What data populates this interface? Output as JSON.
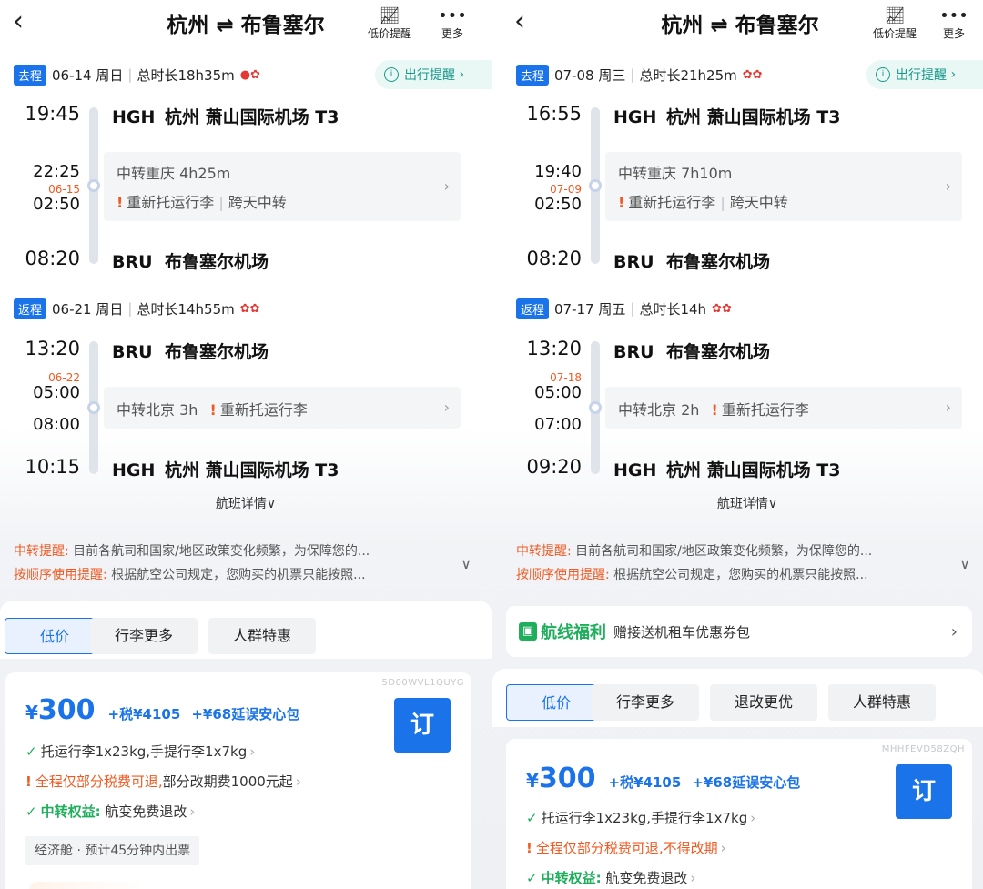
{
  "panels": [
    {
      "header": {
        "back_icon": "back-arrow-icon",
        "title": "杭州 ⇌ 布鲁塞尔",
        "actions": [
          {
            "icon": "price-alert-icon",
            "label": "低价提醒"
          },
          {
            "icon": "more-icon",
            "label": "更多"
          }
        ]
      },
      "outbound": {
        "tag": "去程",
        "date": "06-14 周日",
        "duration": "总时长18h35m",
        "notice": "出行提醒",
        "dep_time": "19:45",
        "dep_code": "HGH",
        "dep_airport": "杭州 萧山国际机场 T3",
        "arr1_time": "22:25",
        "next_date": "06-15",
        "dep2_time": "02:50",
        "transfer": "中转重庆 4h25m",
        "transfer_note": "重新托运行李",
        "transfer_note2": "跨天中转",
        "arr_time": "08:20",
        "arr_code": "BRU",
        "arr_airport": "布鲁塞尔机场"
      },
      "return": {
        "tag": "返程",
        "date": "06-21 周日",
        "duration": "总时长14h55m",
        "dep_time": "13:20",
        "dep_code": "BRU",
        "dep_airport": "布鲁塞尔机场",
        "next_date": "06-22",
        "arr1_time": "05:00",
        "dep2_time": "08:00",
        "transfer": "中转北京 3h",
        "transfer_note": "重新托运行李",
        "arr_time": "10:15",
        "arr_code": "HGH",
        "arr_airport": "杭州 萧山国际机场 T3"
      },
      "detail_link": "航班详情",
      "reminders": [
        {
          "key": "中转提醒:",
          "text": "目前各航司和国家/地区政策变化频繁，为保障您的..."
        },
        {
          "key": "按顺序使用提醒:",
          "text": "根据航空公司规定，您购买的机票只能按照..."
        }
      ],
      "tabs": [
        "低价",
        "行李更多",
        "人群特惠"
      ],
      "offer": {
        "code": "5D00WVL1QUYG",
        "currency": "¥",
        "price": "300",
        "tax": "+税¥4105",
        "addon": "+¥68延误安心包",
        "book": "订",
        "features": [
          {
            "type": "check",
            "text": "托运行李1x23kg,手提行李1x7kg"
          },
          {
            "type": "warn",
            "text": "全程仅部分税费可退,",
            "text2": "部分改期费1000元起"
          },
          {
            "type": "green",
            "label": "中转权益:",
            "text": " 航变免费退改"
          }
        ],
        "cabin": "经济舱 · 预计45分钟内出票"
      }
    },
    {
      "header": {
        "back_icon": "back-arrow-icon",
        "title": "杭州 ⇌ 布鲁塞尔",
        "actions": [
          {
            "icon": "price-alert-icon",
            "label": "低价提醒"
          },
          {
            "icon": "more-icon",
            "label": "更多"
          }
        ]
      },
      "outbound": {
        "tag": "去程",
        "date": "07-08 周三",
        "duration": "总时长21h25m",
        "notice": "出行提醒",
        "dep_time": "16:55",
        "dep_code": "HGH",
        "dep_airport": "杭州 萧山国际机场 T3",
        "arr1_time": "19:40",
        "next_date": "07-09",
        "dep2_time": "02:50",
        "transfer": "中转重庆 7h10m",
        "transfer_note": "重新托运行李",
        "transfer_note2": "跨天中转",
        "arr_time": "08:20",
        "arr_code": "BRU",
        "arr_airport": "布鲁塞尔机场"
      },
      "return": {
        "tag": "返程",
        "date": "07-17 周五",
        "duration": "总时长14h",
        "dep_time": "13:20",
        "dep_code": "BRU",
        "dep_airport": "布鲁塞尔机场",
        "next_date": "07-18",
        "arr1_time": "05:00",
        "dep2_time": "07:00",
        "transfer": "中转北京 2h",
        "transfer_note": "重新托运行李",
        "arr_time": "09:20",
        "arr_code": "HGH",
        "arr_airport": "杭州 萧山国际机场 T3"
      },
      "detail_link": "航班详情",
      "reminders": [
        {
          "key": "中转提醒:",
          "text": "目前各航司和国家/地区政策变化频繁，为保障您的..."
        },
        {
          "key": "按顺序使用提醒:",
          "text": "根据航空公司规定，您购买的机票只能按照..."
        }
      ],
      "benefit": {
        "title": "航线福利",
        "text": "赠接送机租车优惠券包"
      },
      "tabs": [
        "低价",
        "行李更多",
        "退改更优",
        "人群特惠"
      ],
      "offer": {
        "code": "MHHFEVD58ZQH",
        "currency": "¥",
        "price": "300",
        "tax": "+税¥4105",
        "addon": "+¥68延误安心包",
        "book": "订",
        "features": [
          {
            "type": "check",
            "text": "托运行李1x23kg,手提行李1x7kg"
          },
          {
            "type": "warn",
            "text": "全程仅部分税费可退,不得改期"
          },
          {
            "type": "green",
            "label": "中转权益:",
            "text": " 航变免费退改"
          }
        ]
      }
    }
  ],
  "colors": {
    "accent": "#1a73e8",
    "warning": "#f05a22",
    "green": "#1fae5c",
    "teal": "#1a9a8a"
  }
}
